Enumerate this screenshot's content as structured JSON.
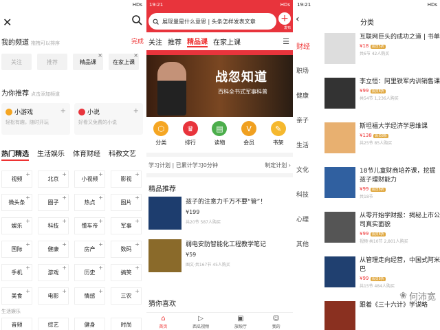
{
  "p1": {
    "status": {
      "time": "",
      "net": "HDs"
    },
    "my_title": "我的频道",
    "my_hint": "拖拽可以排序",
    "done": "完成",
    "my": [
      {
        "l": "关注",
        "g": true
      },
      {
        "l": "推荐",
        "g": true
      },
      {
        "l": "精品课",
        "g": false
      },
      {
        "l": "在家上课",
        "g": false
      }
    ],
    "rec_title": "为你推荐",
    "rec_hint": "点击添加频道",
    "rec": [
      {
        "t": "小游戏",
        "d": "轻松有趣，随时开玩",
        "c": "#f5a623"
      },
      {
        "t": "小说",
        "d": "好看又免费的小说",
        "c": "#e8343c"
      }
    ],
    "tabs": [
      "热门精选",
      "生活娱乐",
      "体育财经",
      "科教文艺"
    ],
    "grid": [
      "视频",
      "北京",
      "小视频",
      "影视",
      "微头条",
      "圈子",
      "热点",
      "图片",
      "娱乐",
      "科技",
      "懂车帝",
      "军事",
      "国际",
      "健康",
      "房产",
      "数码",
      "手机",
      "游戏",
      "历史",
      "搞笑",
      "美食",
      "电影",
      "情感",
      "三农"
    ],
    "sub": "生活娱乐",
    "grid2": [
      "音频",
      "综艺",
      "健身",
      "时尚"
    ]
  },
  "p2": {
    "status": {
      "time": "19:21",
      "net": "HDs"
    },
    "search": "展现量是什么意思 | 头条怎样发表文章",
    "plus": "发布",
    "tabs": [
      "关注",
      "推荐",
      "精品课",
      "在家上课"
    ],
    "banner_title": "战忽知道",
    "banner_sub": "百科全书式军事科普",
    "icons": [
      {
        "l": "分类",
        "c": "#f5a623",
        "g": "⬡"
      },
      {
        "l": "排行",
        "c": "#e8343c",
        "g": "♛"
      },
      {
        "l": "读物",
        "c": "#4cae4c",
        "g": "▤"
      },
      {
        "l": "会员",
        "c": "#f0a020",
        "g": "V"
      },
      {
        "l": "书架",
        "c": "#f5b82e",
        "g": "✎"
      }
    ],
    "plan_l": "学习计划 | 已累计学习0分钟",
    "plan_r": "制定计划 ›",
    "sel_title": "精品推荐",
    "items": [
      {
        "t": "孩子的注意力千万不要“管”！",
        "p": "¥199",
        "m": "共20节  587人购买"
      },
      {
        "t": "弱电安防智能化工程教学笔记",
        "p": "¥59",
        "m": "图文·共167节  45人购买"
      }
    ],
    "guess": "猜你喜欢",
    "nav": [
      {
        "l": "首页",
        "a": true
      },
      {
        "l": "西瓜视频",
        "a": false
      },
      {
        "l": "放映厅",
        "a": false
      },
      {
        "l": "我的",
        "a": false
      }
    ]
  },
  "p3": {
    "status": {
      "time": "19:21",
      "net": "HDs"
    },
    "title": "分类",
    "cats": [
      "财经",
      "职场",
      "健康",
      "亲子",
      "生活",
      "文化",
      "科技",
      "心理",
      "其他"
    ],
    "items": [
      {
        "t": "互联网巨头的成功之道 | 书单",
        "p": "¥18",
        "vip": "会员5折",
        "m": "共6节  42人购买",
        "c": "#ddd"
      },
      {
        "t": "李立恒：阿里铁军内训销售课",
        "p": "¥99",
        "vip": "会员8折",
        "m": "共54节  1,236人购买",
        "c": "#333"
      },
      {
        "t": "斯坦福大学经济学思维课",
        "p": "¥138",
        "vip": "会员8折",
        "m": "共25节  85人购买",
        "c": "#e8b070"
      },
      {
        "t": "18节儿童财商培养课，挖掘孩子理财能力",
        "p": "¥99",
        "vip": "会员8折",
        "m": "共18节",
        "c": "#3060a0"
      },
      {
        "t": "从零开始学财报：揭秘上市公司真实面貌",
        "p": "¥99",
        "vip": "会员8折",
        "m": "视频·共10节  2,801人购买",
        "c": "#555"
      },
      {
        "t": "从管理走向经营，中国式阿米巴",
        "p": "¥99",
        "vip": "会员8折",
        "m": "共15节  484人购买",
        "c": "#204070"
      },
      {
        "t": "跟着《三十六计》学谋略",
        "p": "",
        "vip": "",
        "m": "",
        "c": "#8a3020"
      }
    ],
    "watermark": "何沛宽"
  }
}
